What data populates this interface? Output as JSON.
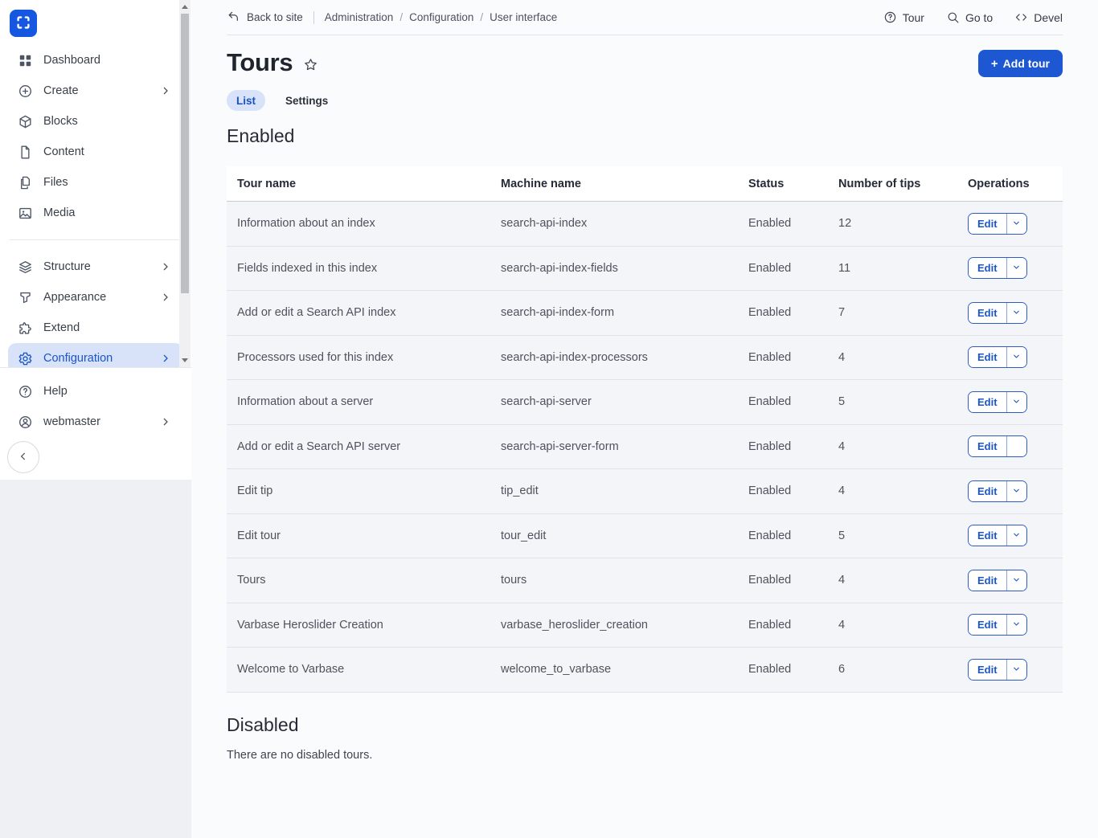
{
  "sidebar": {
    "items": [
      {
        "label": "Dashboard",
        "icon": "dashboard-icon"
      },
      {
        "label": "Create",
        "icon": "create-icon",
        "chevron": true
      },
      {
        "label": "Blocks",
        "icon": "blocks-icon"
      },
      {
        "label": "Content",
        "icon": "content-icon"
      },
      {
        "label": "Files",
        "icon": "files-icon"
      },
      {
        "label": "Media",
        "icon": "media-icon"
      },
      {
        "divider": true
      },
      {
        "label": "Structure",
        "icon": "structure-icon",
        "chevron": true
      },
      {
        "label": "Appearance",
        "icon": "appearance-icon",
        "chevron": true
      },
      {
        "label": "Extend",
        "icon": "extend-icon"
      },
      {
        "label": "Configuration",
        "icon": "configuration-icon",
        "chevron": true,
        "active": true
      }
    ],
    "footer_items": [
      {
        "label": "Help",
        "icon": "help-icon"
      },
      {
        "label": "webmaster",
        "icon": "user-icon",
        "chevron": true
      }
    ]
  },
  "topbar": {
    "back": {
      "label": "Back to site",
      "icon": "back-arrow-icon"
    },
    "breadcrumbs": [
      "Administration",
      "Configuration",
      "User interface"
    ],
    "actions": [
      {
        "label": "Tour",
        "icon": "help-circle-icon"
      },
      {
        "label": "Go to",
        "icon": "search-icon"
      },
      {
        "label": "Devel",
        "icon": "code-icon"
      }
    ]
  },
  "page": {
    "title": "Tours",
    "favorite_icon": "star-icon",
    "add_button": {
      "plus": "+",
      "label": "Add tour"
    },
    "tabs": [
      {
        "label": "List",
        "active": true
      },
      {
        "label": "Settings",
        "active": false
      }
    ],
    "enabled_heading": "Enabled",
    "disabled_heading": "Disabled",
    "disabled_empty_text": "There are no disabled tours."
  },
  "table": {
    "columns": [
      "Tour name",
      "Machine name",
      "Status",
      "Number of tips",
      "Operations"
    ],
    "edit_label": "Edit",
    "rows": [
      {
        "tour_name": "Information about an index",
        "machine_name": "search-api-index",
        "status": "Enabled",
        "tips": "12",
        "dropdown": true
      },
      {
        "tour_name": "Fields indexed in this index",
        "machine_name": "search-api-index-fields",
        "status": "Enabled",
        "tips": "11",
        "dropdown": true
      },
      {
        "tour_name": "Add or edit a Search API index",
        "machine_name": "search-api-index-form",
        "status": "Enabled",
        "tips": "7",
        "dropdown": true
      },
      {
        "tour_name": "Processors used for this index",
        "machine_name": "search-api-index-processors",
        "status": "Enabled",
        "tips": "4",
        "dropdown": true
      },
      {
        "tour_name": "Information about a server",
        "machine_name": "search-api-server",
        "status": "Enabled",
        "tips": "5",
        "dropdown": true
      },
      {
        "tour_name": "Add or edit a Search API server",
        "machine_name": "search-api-server-form",
        "status": "Enabled",
        "tips": "4",
        "dropdown": false
      },
      {
        "tour_name": "Edit tip",
        "machine_name": "tip_edit",
        "status": "Enabled",
        "tips": "4",
        "dropdown": true
      },
      {
        "tour_name": "Edit tour",
        "machine_name": "tour_edit",
        "status": "Enabled",
        "tips": "5",
        "dropdown": true
      },
      {
        "tour_name": "Tours",
        "machine_name": "tours",
        "status": "Enabled",
        "tips": "4",
        "dropdown": true
      },
      {
        "tour_name": "Varbase Heroslider Creation",
        "machine_name": "varbase_heroslider_creation",
        "status": "Enabled",
        "tips": "4",
        "dropdown": true
      },
      {
        "tour_name": "Welcome to Varbase",
        "machine_name": "welcome_to_varbase",
        "status": "Enabled",
        "tips": "6",
        "dropdown": true
      }
    ]
  },
  "colors": {
    "accent": "#1b55c8",
    "button_bg": "#1d58d2",
    "active_item_bg": "#d8e3f9",
    "row_bg": "#f3f5f9",
    "content_bg": "#fafbfd"
  }
}
